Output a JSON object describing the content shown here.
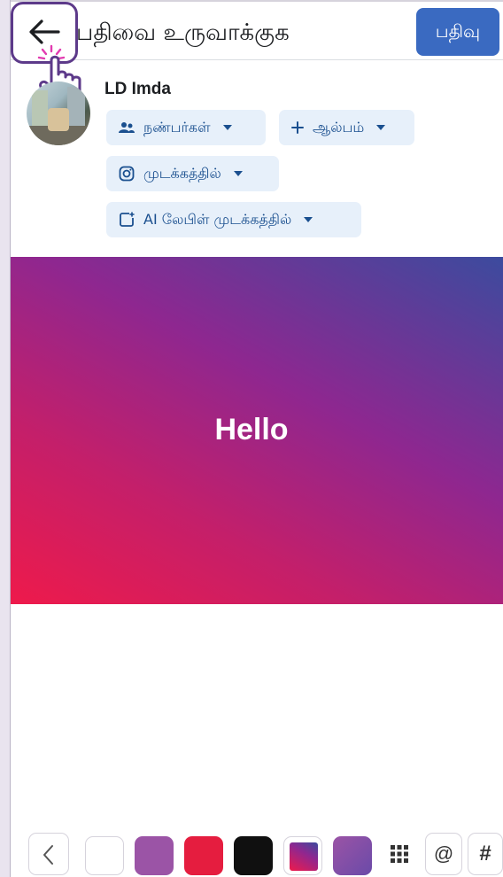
{
  "header": {
    "title": "பதிவை உருவாக்குக",
    "post_label": "பதிவு"
  },
  "user": {
    "name": "LD Imda"
  },
  "audience": {
    "friends_label": "நண்பர்கள்",
    "album_label": "ஆல்பம்",
    "instagram_label": "முடக்கத்தில்",
    "ai_label": "AI லேபிள் முடக்கத்தில்"
  },
  "canvas": {
    "text": "Hello"
  },
  "toolbar": {
    "at_label": "@",
    "hash_label": "#",
    "swatches": [
      {
        "name": "white",
        "color": "#ffffff"
      },
      {
        "name": "purple",
        "color": "#9b54a6"
      },
      {
        "name": "red",
        "color": "#e51d3f"
      },
      {
        "name": "black",
        "color": "#101010"
      },
      {
        "name": "gradient-red-blue",
        "color": "#8e2790"
      },
      {
        "name": "gradient-purple",
        "color": "#7a50a8"
      }
    ]
  },
  "colors": {
    "primary": "#3a6ac1",
    "chip_bg": "#e7f0fa",
    "chip_text": "#1a4f8f",
    "highlight": "#5d3a8a"
  }
}
